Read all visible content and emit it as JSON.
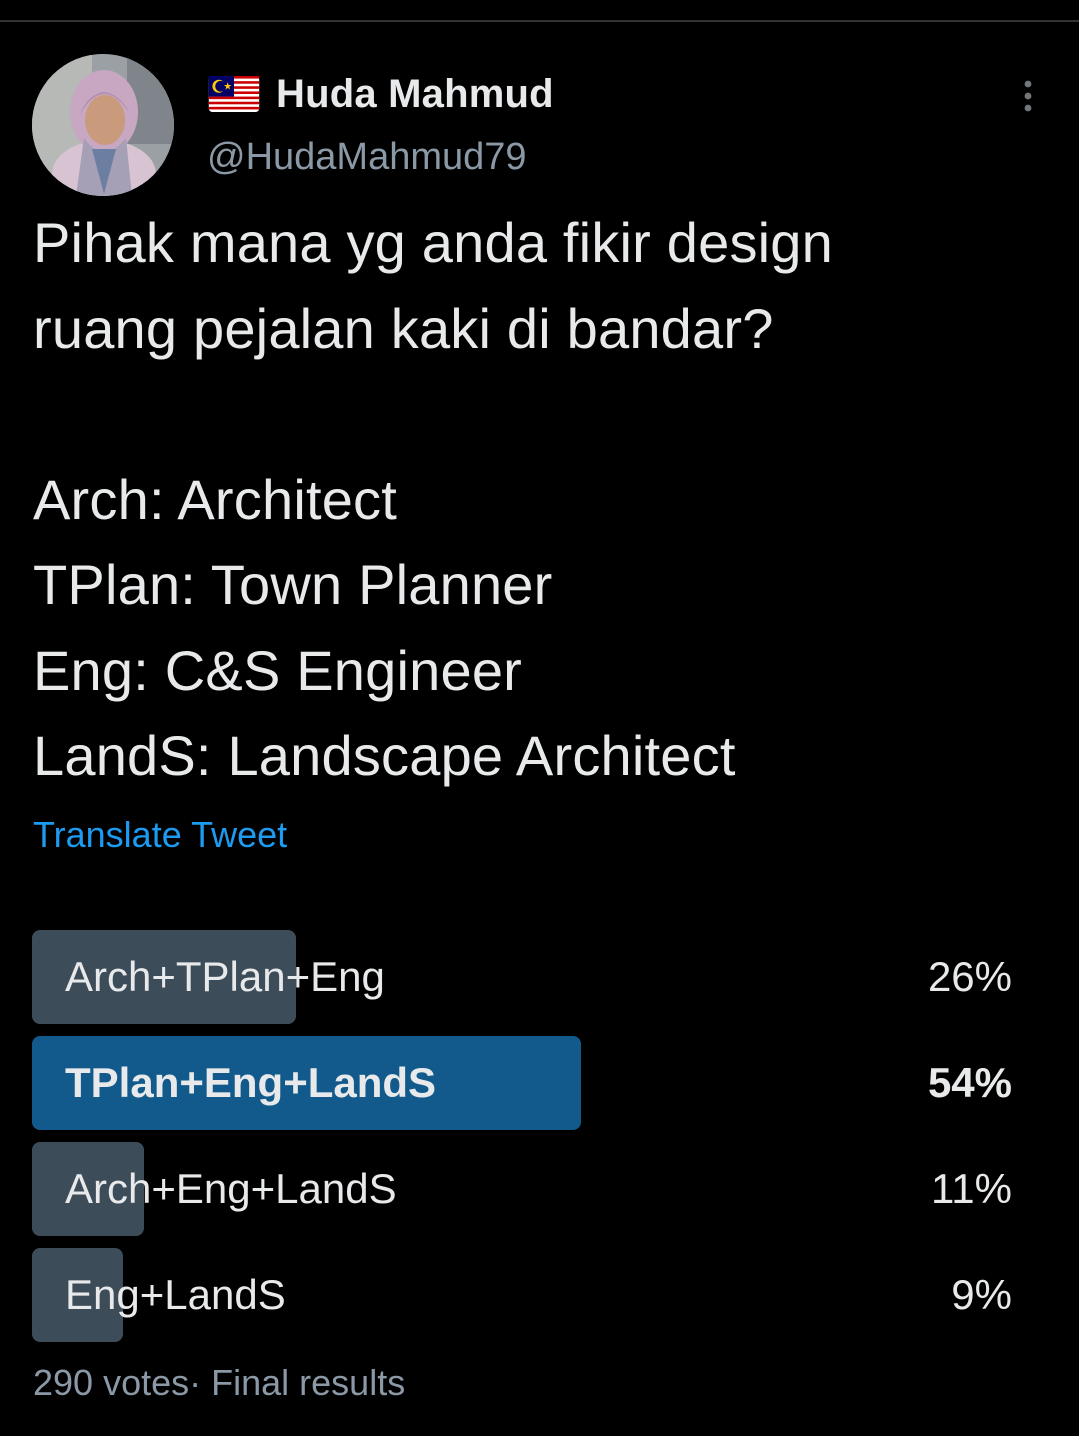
{
  "author": {
    "display_name": "Huda Mahmud",
    "handle": "@HudaMahmud79",
    "flag_icon": "malaysia-flag-icon"
  },
  "tweet": {
    "lines": [
      "Pihak mana yg anda fikir design",
      "ruang pejalan kaki di bandar?",
      "",
      "Arch: Architect",
      "TPlan: Town Planner",
      "Eng: C&S Engineer",
      "LandS: Landscape Architect"
    ],
    "translate_label": "Translate Tweet"
  },
  "poll": {
    "options": [
      {
        "label": "Arch+TPlan+Eng",
        "percent_label": "26%",
        "percent": 26,
        "winner": false
      },
      {
        "label": "TPlan+Eng+LandS",
        "percent_label": "54%",
        "percent": 54,
        "winner": true
      },
      {
        "label": "Arch+Eng+LandS",
        "percent_label": "11%",
        "percent": 11,
        "winner": false
      },
      {
        "label": "Eng+LandS",
        "percent_label": "9%",
        "percent": 9,
        "winner": false
      }
    ],
    "votes": "290 votes",
    "separator": "·",
    "status": "Final results"
  },
  "colors": {
    "background": "#000000",
    "text": "#e7e9ea",
    "muted": "#8b98a5",
    "link": "#1d9bf0",
    "bar": "#3d4c59",
    "winner_bar": "#135a8c"
  },
  "icons": {
    "more": "more-vertical-icon"
  }
}
